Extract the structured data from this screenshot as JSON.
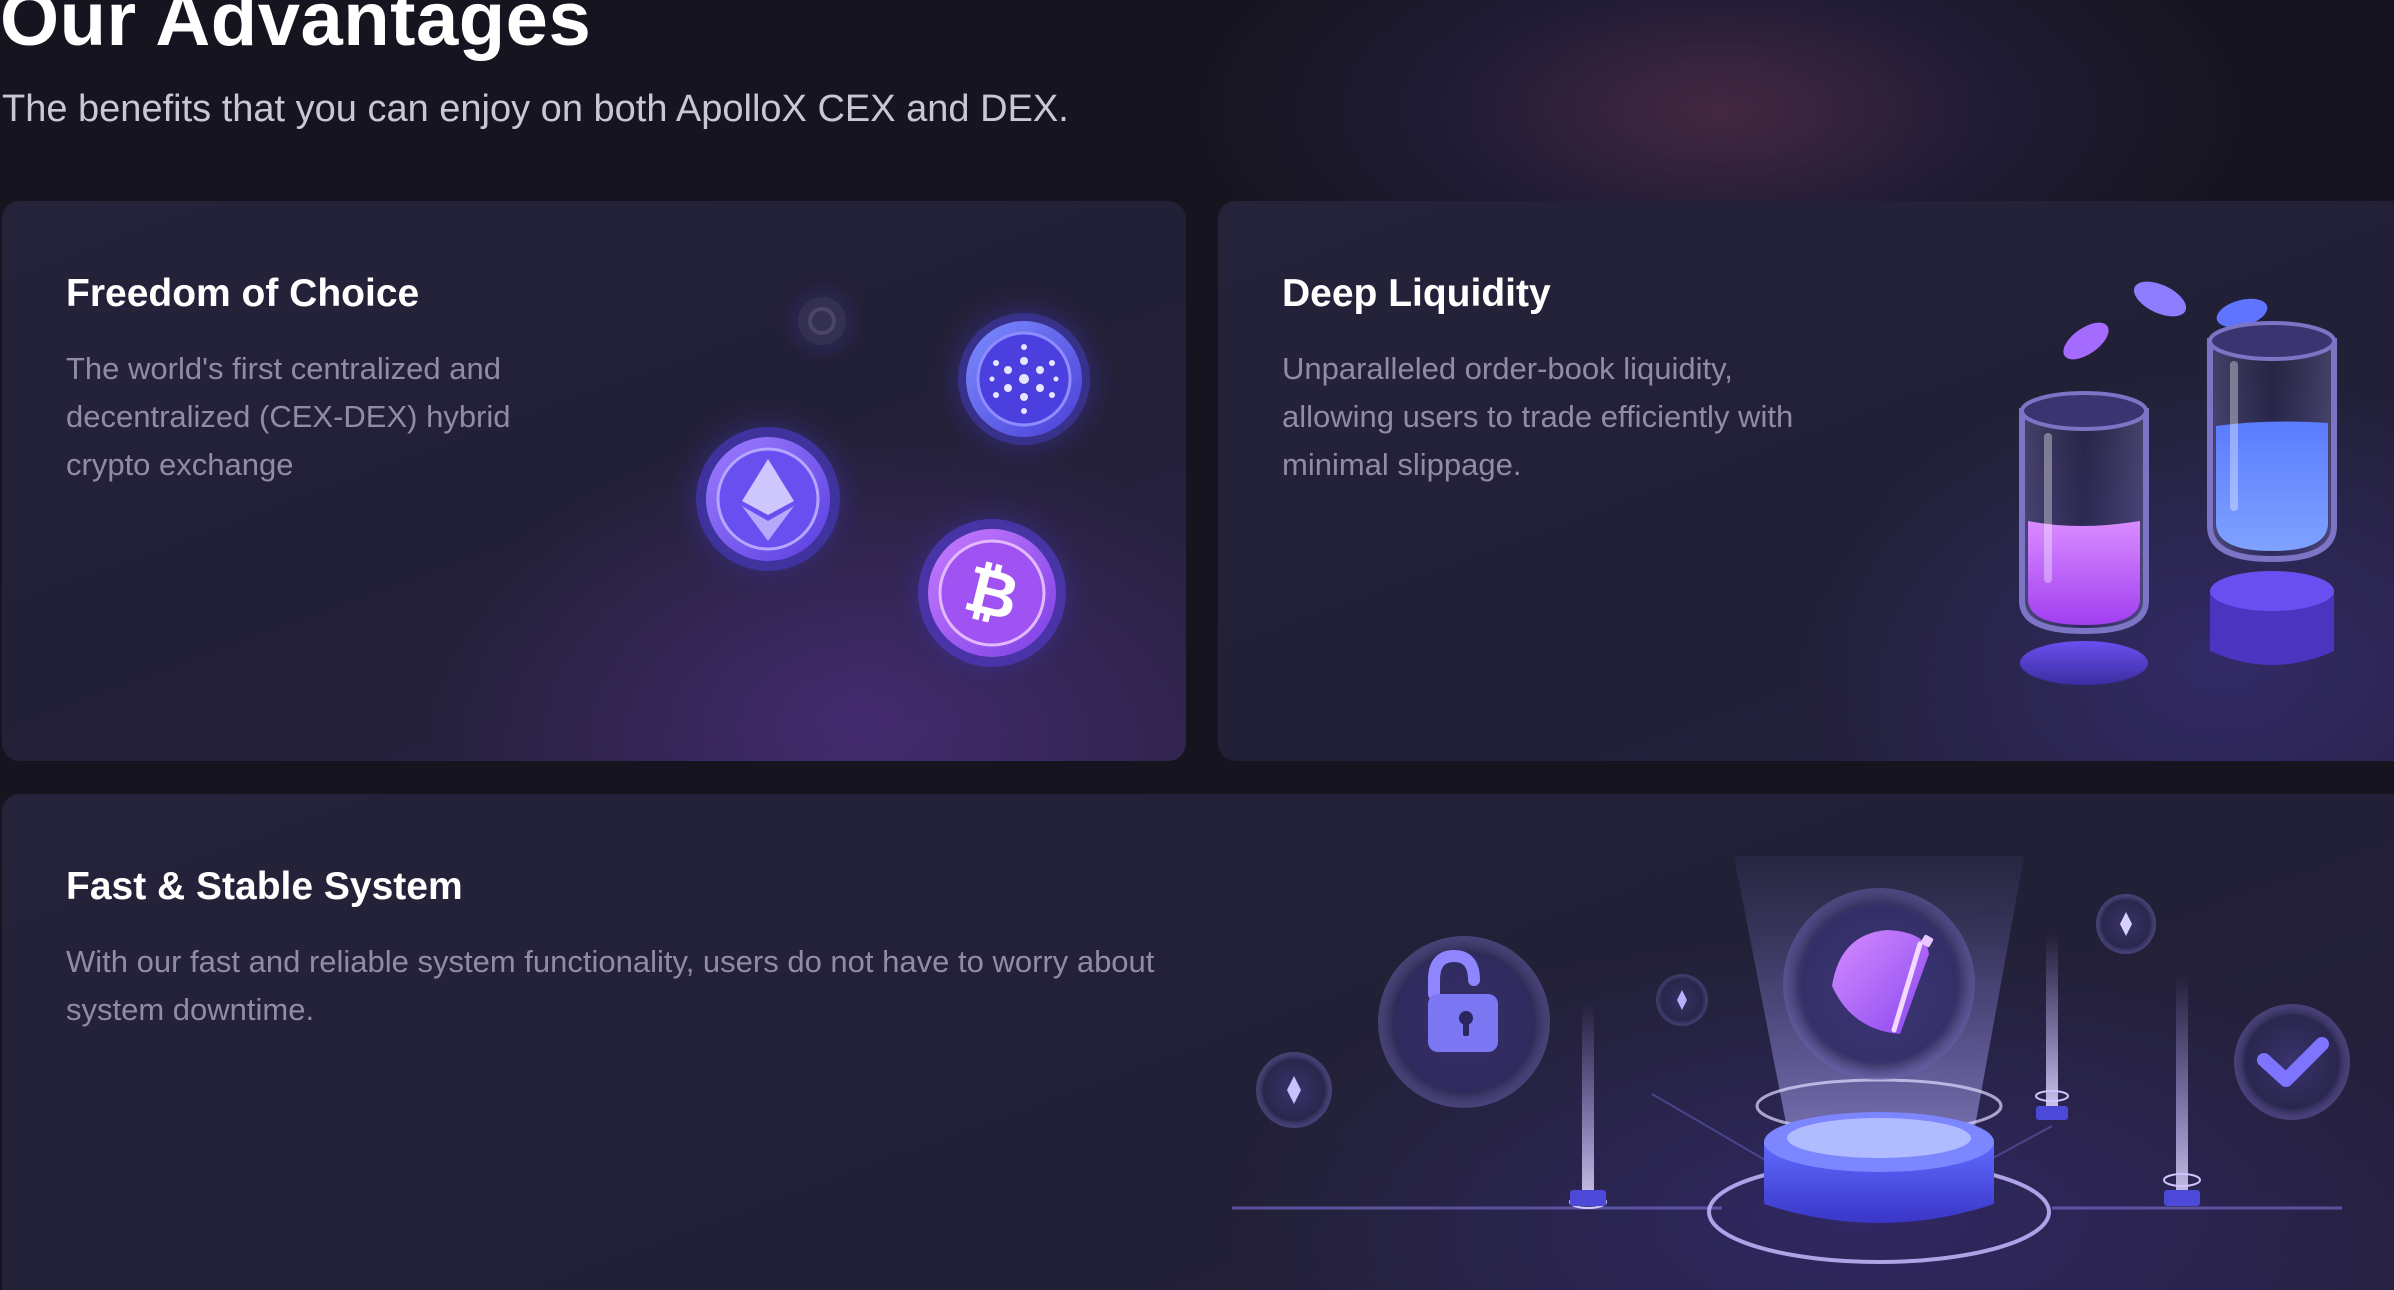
{
  "section": {
    "title": "Our Advantages",
    "subtitle": "The benefits that you can enjoy on both ApolloX CEX and DEX."
  },
  "cards": [
    {
      "title": "Freedom of Choice",
      "description": "The world's first centralized and decentralized (CEX-DEX) hybrid crypto exchange",
      "illustration_icons": [
        "ethereum-coin-icon",
        "bitcoin-coin-icon",
        "cardano-coin-icon"
      ]
    },
    {
      "title": "Deep Liquidity",
      "description": "Unparalleled order-book liquidity, allowing users to trade efficiently with minimal slippage.",
      "illustration_icons": [
        "liquidity-tube-icon",
        "coin-icon"
      ]
    },
    {
      "title": "Fast & Stable System",
      "description": "With our fast and reliable system functionality, users do not have to worry about system downtime.",
      "illustration_icons": [
        "lock-icon",
        "check-icon",
        "logo-coin-icon",
        "diamond-icon"
      ]
    }
  ],
  "colors": {
    "background": "#16151f",
    "card": "#23213a",
    "accent_purple": "#a855f7",
    "accent_blue": "#4f62f5",
    "text_primary": "#ffffff",
    "text_secondary": "#8f8ca4"
  }
}
